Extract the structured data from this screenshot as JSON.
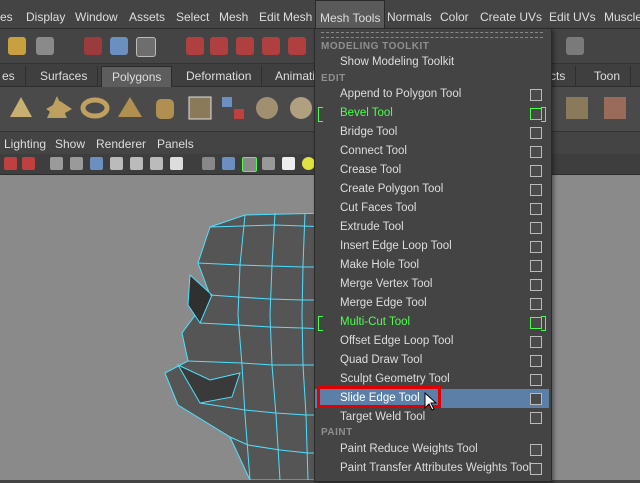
{
  "menubar": {
    "items": [
      "es",
      "Display",
      "Window",
      "Assets",
      "Select",
      "Mesh",
      "Edit Mesh",
      "Mesh Tools",
      "Normals",
      "Color",
      "Create UVs",
      "Edit UVs",
      "Muscle"
    ],
    "active": "Mesh Tools"
  },
  "shelf_tabs": {
    "items": [
      "es",
      "Surfaces",
      "Polygons",
      "Deformation",
      "Animatio",
      "cts",
      "Toon"
    ],
    "active": "Polygons"
  },
  "panel_menu": {
    "items": [
      "Lighting",
      "Show",
      "Renderer",
      "Panels"
    ]
  },
  "dropdown": {
    "sections": {
      "modeling": "MODELING TOOLKIT",
      "edit": "EDIT",
      "paint": "PAINT"
    },
    "modeling_items": [
      {
        "label": "Show Modeling Toolkit"
      }
    ],
    "edit_items": [
      {
        "label": "Append to Polygon Tool",
        "state": "normal"
      },
      {
        "label": "Bevel Tool",
        "state": "green"
      },
      {
        "label": "Bridge Tool",
        "state": "normal"
      },
      {
        "label": "Connect Tool",
        "state": "normal"
      },
      {
        "label": "Crease Tool",
        "state": "normal"
      },
      {
        "label": "Create Polygon Tool",
        "state": "normal"
      },
      {
        "label": "Cut Faces Tool",
        "state": "normal"
      },
      {
        "label": "Extrude Tool",
        "state": "normal"
      },
      {
        "label": "Insert Edge Loop Tool",
        "state": "normal"
      },
      {
        "label": "Make Hole Tool",
        "state": "normal"
      },
      {
        "label": "Merge Vertex Tool",
        "state": "normal"
      },
      {
        "label": "Merge Edge Tool",
        "state": "normal"
      },
      {
        "label": "Multi-Cut Tool",
        "state": "green"
      },
      {
        "label": "Offset Edge Loop Tool",
        "state": "normal"
      },
      {
        "label": "Quad Draw Tool",
        "state": "normal"
      },
      {
        "label": "Sculpt Geometry Tool",
        "state": "normal"
      },
      {
        "label": "Slide Edge Tool",
        "state": "highlighted"
      },
      {
        "label": "Target Weld Tool",
        "state": "normal"
      }
    ],
    "paint_items": [
      {
        "label": "Paint Reduce Weights Tool"
      },
      {
        "label": "Paint Transfer Attributes Weights Tool"
      }
    ]
  },
  "colors": {
    "accent_green": "#4cff4c",
    "highlight_blue": "#5b7fa6",
    "annotation_red": "#e00000",
    "wireframe_cyan": "#4fe0ff"
  }
}
